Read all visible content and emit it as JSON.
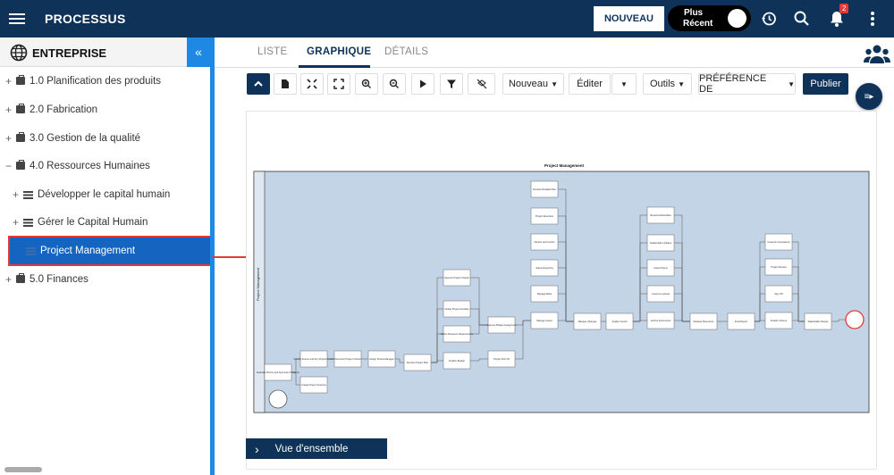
{
  "app": {
    "title": "PROCESSUS"
  },
  "header": {
    "new_button": "NOUVEAU",
    "recent_line1": "Plus",
    "recent_line2": "Récent",
    "notification_count": "2"
  },
  "sidebar": {
    "title": "ENTREPRISE",
    "items": [
      {
        "toggle": "+",
        "label": "1.0 Planification des produits"
      },
      {
        "toggle": "+",
        "label": "2.0 Fabrication"
      },
      {
        "toggle": "+",
        "label": "3.0 Gestion de la qualité"
      },
      {
        "toggle": "−",
        "label": "4.0 Ressources Humaines"
      },
      {
        "toggle": "+",
        "label": "Développer le capital humain"
      },
      {
        "toggle": "+",
        "label": "Gérer le Capital Humain"
      },
      {
        "toggle": "",
        "label": "Project Management"
      },
      {
        "toggle": "+",
        "label": "5.0 Finances"
      }
    ]
  },
  "tabs": [
    {
      "label": "LISTE"
    },
    {
      "label": "GRAPHIQUE"
    },
    {
      "label": "DÉTAILS"
    }
  ],
  "toolbar": {
    "nouveau": "Nouveau",
    "editer": "Éditer",
    "outils": "Outils",
    "preference": "PRÉFÉRENCE DE",
    "publier": "Publier"
  },
  "diagram": {
    "title": "Project Management",
    "lane_label": "Project Management",
    "boxes": [
      "Evaluate Priority and Approval of Projects",
      "Identify Source and Key Project Details",
      "Document Project Charter",
      "Assign Project Manager",
      "Develop Project Plan",
      "Create Project Structure",
      "Approve Project Charter",
      "Initiate Project Activities",
      "Define Resource Requirements",
      "Finalize Budget",
      "Approve Budget Assignment",
      "Project Kick Off",
      "Develop Detailed Plan",
      "Project Execution",
      "Monitor and Control",
      "Status Reporting",
      "Manage Risks",
      "Manage Issues",
      "Manage Changes",
      "Quality Control",
      "Review Deliverables",
      "Stakeholder Updates",
      "Close Project",
      "Lessons Learned",
      "Archive Documents",
      "Release Resources",
      "Final Report",
      "Customer Acceptance",
      "Project Review",
      "Sign Off",
      "Finalize Closure",
      "Stakeholder Review",
      "Complete Project",
      "End"
    ]
  },
  "overview": {
    "label": "Vue d'ensemble"
  }
}
